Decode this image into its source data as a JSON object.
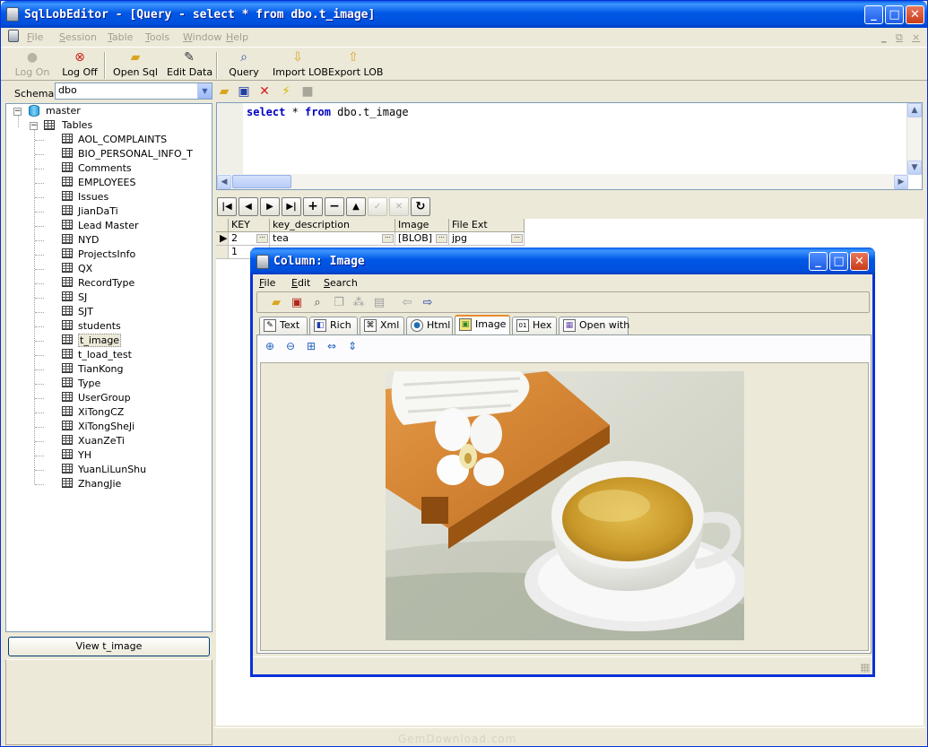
{
  "window": {
    "title": "SqlLobEditor - [Query - select * from dbo.t_image]",
    "controls": {
      "minimize": "_",
      "maximize": "□",
      "close": "✕"
    },
    "mdi_controls": [
      "_",
      "⧉",
      "×"
    ]
  },
  "menu": [
    "File",
    "Session",
    "Table",
    "Tools",
    "Window",
    "Help"
  ],
  "toolbar": [
    {
      "label": "Log On",
      "icon": "person-icon",
      "enabled": false
    },
    {
      "label": "Log Off",
      "icon": "log-off-icon",
      "enabled": true
    },
    {
      "label": "Open Sql",
      "icon": "folder-icon",
      "enabled": true
    },
    {
      "label": "Edit Data",
      "icon": "edit-data-icon",
      "enabled": true
    },
    {
      "label": "Query",
      "icon": "query-icon",
      "enabled": true
    },
    {
      "label": "Import LOB",
      "icon": "import-icon",
      "enabled": true
    },
    {
      "label": "Export LOB",
      "icon": "export-icon",
      "enabled": true
    }
  ],
  "schema": {
    "label": "Schema",
    "value": "dbo"
  },
  "tree": {
    "root": "master",
    "folder": "Tables",
    "tables": [
      "AOL_COMPLAINTS",
      "BIO_PERSONAL_INFO_T",
      "Comments",
      "EMPLOYEES",
      "Issues",
      "JianDaTi",
      "Lead Master",
      "NYD",
      "ProjectsInfo",
      "QX",
      "RecordType",
      "SJ",
      "SJT",
      "students",
      "t_image",
      "t_load_test",
      "TianKong",
      "Type",
      "UserGroup",
      "XiTongCZ",
      "XiTongSheJi",
      "XuanZeTi",
      "YH",
      "YuanLiLunShu",
      "ZhangJie"
    ],
    "selected": "t_image"
  },
  "view_button": "View t_image",
  "editor": {
    "kw1": "select",
    "star": " * ",
    "kw2": "from",
    "rest": " dbo.t_image"
  },
  "grid": {
    "columns": [
      "KEY",
      "key_description",
      "Image",
      "File Ext"
    ],
    "rows": [
      {
        "key": "2",
        "desc": "tea",
        "image": "[BLOB]",
        "ext": "jpg"
      },
      {
        "key": "1",
        "desc": "",
        "image": "",
        "ext": ""
      }
    ]
  },
  "popup": {
    "title": "Column: Image",
    "menu": [
      "File",
      "Edit",
      "Search"
    ],
    "tabs": [
      "Text",
      "Rich",
      "Xml",
      "Html",
      "Image",
      "Hex",
      "Open with"
    ],
    "active_tab": "Image"
  },
  "watermark": "GemDownload.com",
  "colors": {
    "titlebar": "#0054e3",
    "keyword": "#0000c0",
    "active_tab_accent": "#e68b2c"
  }
}
